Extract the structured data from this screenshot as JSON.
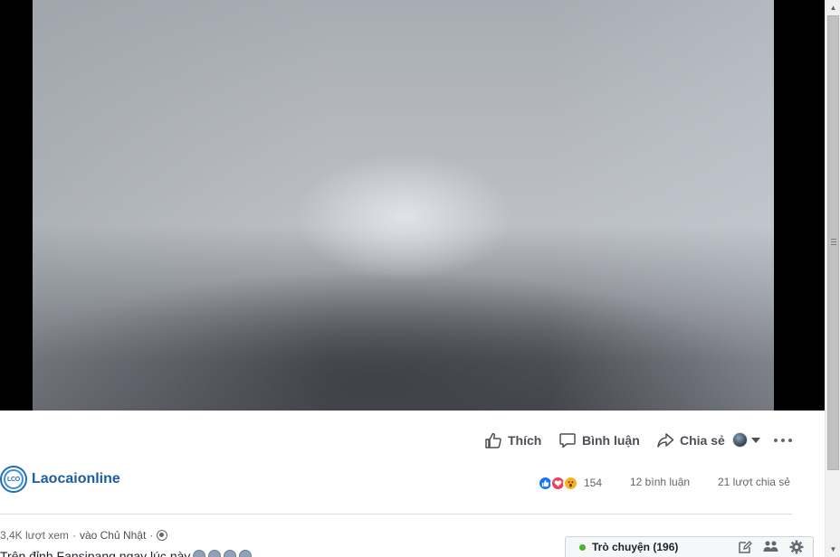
{
  "video": {
    "description_visible": ""
  },
  "actions": {
    "like_label": "Thích",
    "comment_label": "Bình luận",
    "share_label": "Chia sẻ"
  },
  "page": {
    "name": "Laocaionline",
    "avatar_text": "LCO"
  },
  "stats": {
    "reactions_count": "154",
    "comments": "12 bình luận",
    "shares": "21 lượt chia sẻ",
    "reaction_types": [
      "like",
      "love",
      "wow"
    ]
  },
  "meta": {
    "views": "3,4K lượt xem",
    "separator": "·",
    "time": "vào Chủ Nhật",
    "privacy": "globe-icon"
  },
  "caption": {
    "text": "Trên đỉnh Fansipang ngay lúc này",
    "emoji_count": 4
  },
  "chat": {
    "label": "Trò chuyện (196)",
    "status_color": "#42b72a"
  },
  "colors": {
    "brand_link": "#1f5b9e",
    "secondary_text": "#606770",
    "like": "#1877f2",
    "love": "#f33e58",
    "wow": "#f7b125"
  }
}
